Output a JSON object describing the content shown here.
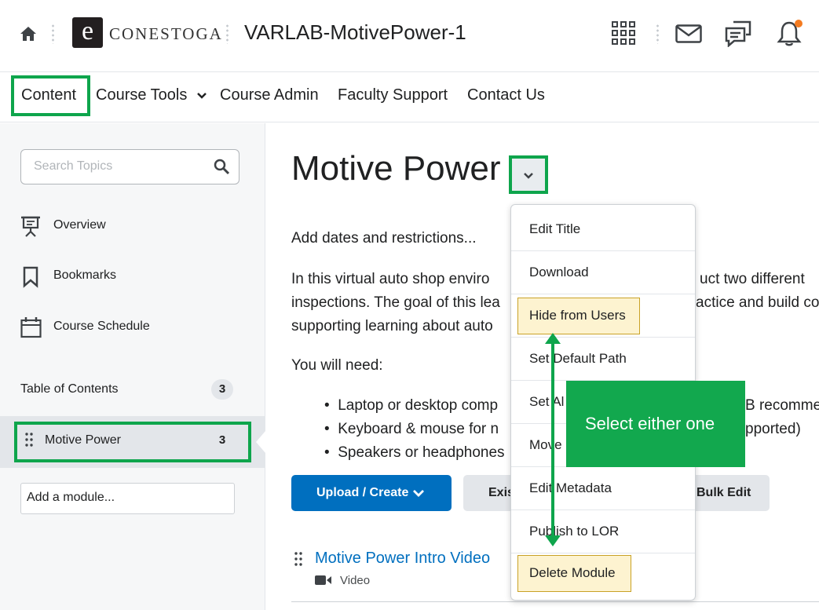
{
  "header": {
    "logo_letter": "e",
    "logo_text": "CONESTOGA",
    "course_title": "VARLAB-MotivePower-1",
    "icons": [
      "home-icon",
      "app-grid-icon",
      "mail-icon",
      "chat-icon",
      "bell-icon"
    ],
    "notification_dot_color": "#f47b20"
  },
  "nav": {
    "items": [
      "Content",
      "Course Tools",
      "Course Admin",
      "Faculty Support",
      "Contact Us"
    ]
  },
  "sidebar": {
    "search_placeholder": "Search Topics",
    "items": [
      {
        "label": "Overview",
        "icon": "presentation-icon"
      },
      {
        "label": "Bookmarks",
        "icon": "bookmark-icon"
      },
      {
        "label": "Course Schedule",
        "icon": "calendar-icon"
      }
    ],
    "toc_label": "Table of Contents",
    "toc_count": "3",
    "module_label": "Motive Power",
    "module_count": "3",
    "add_module_placeholder": "Add a module..."
  },
  "main": {
    "title": "Motive Power",
    "add_dates": "Add dates and restrictions...",
    "paragraph_lines": [
      "In this virtual auto shop enviro",
      "inspections. The goal of this lea",
      "supporting learning about auto"
    ],
    "paragraph_right_lines": [
      "uct two different",
      "actice and build co"
    ],
    "you_will_need": "You will need:",
    "bullets": [
      "Laptop or desktop comp",
      "Keyboard & mouse for n",
      "Speakers or headphones"
    ],
    "bullet_right": [
      "B recomme",
      "pported)"
    ],
    "upload_button": "Upload / Create",
    "existing_button": "Exis",
    "bulk_edit_button": "Bulk Edit",
    "topic_title": "Motive Power Intro Video",
    "topic_type": "Video"
  },
  "menu": {
    "items": [
      "Edit Title",
      "Download",
      "Hide from Users",
      "Set Default Path",
      "Set Al",
      "Move",
      "Edit Metadata",
      "Publish to LOR",
      "Delete Module"
    ]
  },
  "annotation": {
    "callout_text": "Select either one",
    "accent_color": "#0ea54c"
  }
}
